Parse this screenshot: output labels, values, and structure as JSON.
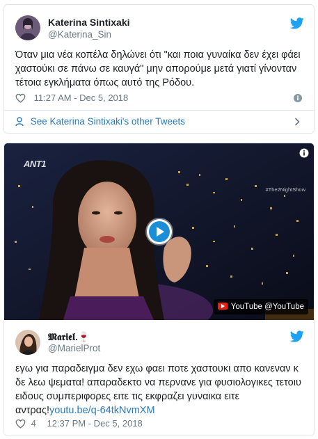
{
  "tweet1": {
    "author_name": "Katerina Sintixaki",
    "author_handle": "@Katerina_Sin",
    "text": "Όταν μια νέα κοπέλα δηλώνει ότι \"και ποια γυναίκα δεν έχει φάει χαστούκι σε πάνω σε καυγά\" μην απορούμε μετά γιατί γίνονταν τέτοια εγκλήματα όπως αυτό της Ρόδου.",
    "timestamp": "11:27 AM - Dec 5, 2018",
    "see_more": "See Katerina Sintixaki's other Tweets"
  },
  "video": {
    "channel_logo": "ANT1",
    "hashtag": "#The2NightShow",
    "badge": "YouTube @YouTube"
  },
  "tweet2": {
    "author_name": "𝕸𝖆𝖗𝖎𝖊𝖑.🍷",
    "author_handle": "@MarielProt",
    "text": "εγω για παραδειγμα δεν εχω φαει ποτε χαστουκι απο κανεναν κ δε λεω ψεματα! απαραδεκτο να περνανε για φυσιολογικες τετοιυ ειδους συμπεριφορες ειτε τις εκφραζει γυναικα ειτε αντρας!",
    "link": "youtu.be/q-64tkNvmXM",
    "like_count": "4",
    "timestamp": "12:37 PM - Dec 5, 2018"
  },
  "colors": {
    "twitter_blue": "#1da1f2",
    "link_blue": "#2b7bb9",
    "meta_gray": "#697882",
    "border": "#e1e8ed"
  },
  "icons": [
    "twitter-bird-icon",
    "heart-icon",
    "info-icon",
    "person-icon",
    "chevron-right-icon",
    "play-icon",
    "youtube-icon"
  ]
}
